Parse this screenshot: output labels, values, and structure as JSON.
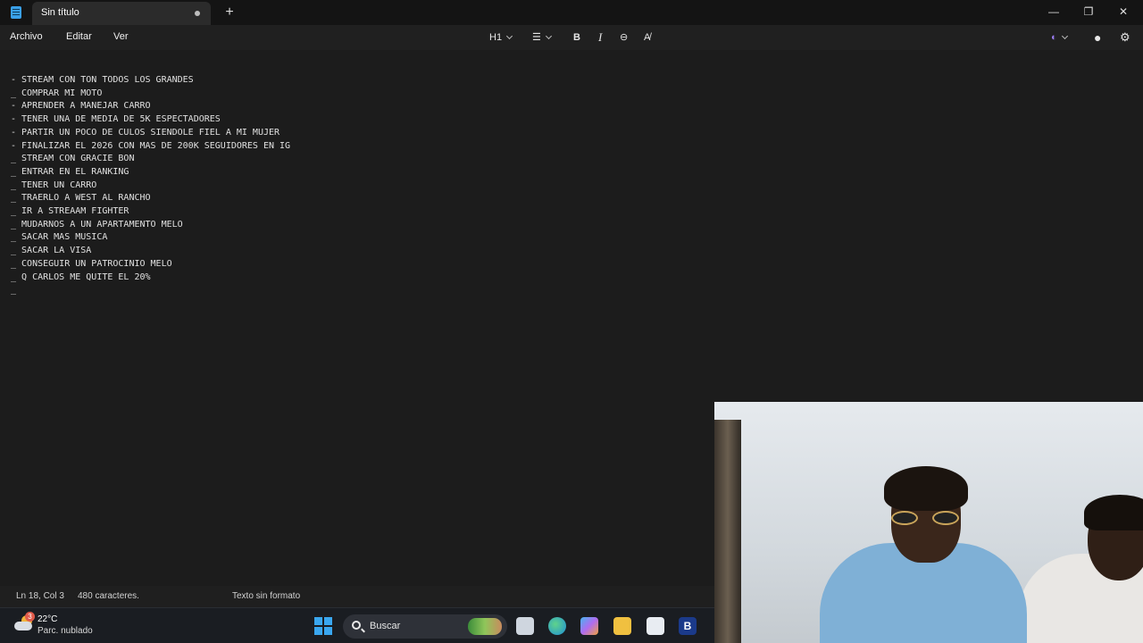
{
  "window": {
    "tab_title": "Sin título",
    "new_tab_glyph": "+",
    "minimize_glyph": "—",
    "maximize_glyph": "❐",
    "close_glyph": "✕"
  },
  "menu": {
    "items": [
      "Archivo",
      "Editar",
      "Ver"
    ]
  },
  "toolbar": {
    "heading_label": "H1",
    "list_glyph": "☰",
    "bold_label": "B",
    "italic_label": "I",
    "link_glyph": "⊖",
    "clear_format_glyph": "A̸",
    "copilot_glyph": "◐",
    "account_glyph": "●",
    "settings_glyph": "⚙"
  },
  "document": {
    "lines": [
      "- STREAM CON TON TODOS LOS GRANDES",
      "_ COMPRAR MI MOTO",
      "- APRENDER A MANEJAR CARRO",
      "- TENER UNA DE MEDIA DE 5K ESPECTADORES",
      "- PARTIR UN POCO DE CULOS SIENDOLE FIEL A MI MUJER",
      "- FINALIZAR EL 2026 CON MAS DE 200K SEGUIDORES EN IG",
      "_ STREAM CON GRACIE BON",
      "_ ENTRAR EN EL RANKING",
      "_ TENER UN CARRO",
      "_ TRAERLO A WEST AL RANCHO",
      "_ IR A STREAAM FIGHTER",
      "_ MUDARNOS A UN APARTAMENTO MELO",
      "_ SACAR MAS MUSICA",
      "_ SACAR LA VISA",
      "_ CONSEGUIR UN PATROCINIO MELO",
      "_ Q CARLOS ME QUITE EL 20%",
      "_"
    ]
  },
  "status": {
    "position": "Ln 18, Col 3",
    "char_count": "480 caracteres.",
    "format": "Texto sin formato"
  },
  "taskbar": {
    "weather_temp": "22°C",
    "weather_condition": "Parc. nublado",
    "weather_badge": "3",
    "search_label": "Buscar",
    "apps": [
      "file-explorer-icon",
      "edge-icon",
      "copilot-icon",
      "folder-icon",
      "store-icon",
      "b-app-icon"
    ],
    "b_app_label": "B"
  }
}
